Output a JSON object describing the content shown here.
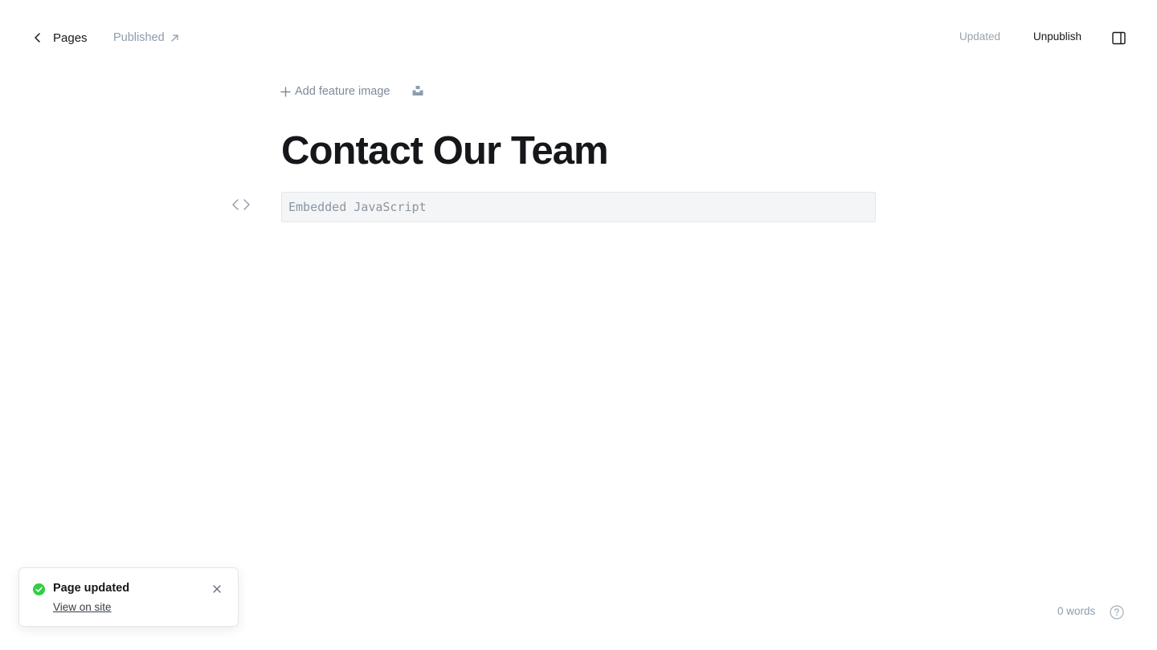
{
  "header": {
    "back_label": "Pages",
    "status_label": "Published",
    "save_state": "Updated",
    "unpublish_label": "Unpublish"
  },
  "editor": {
    "feature_image_label": "Add feature image",
    "title": "Contact Our Team",
    "embed_placeholder": "Embedded JavaScript"
  },
  "toast": {
    "title": "Page updated",
    "link_label": "View on site"
  },
  "footer": {
    "word_count": "0 words"
  },
  "colors": {
    "accent_success": "#30cf43",
    "text_primary": "#15171a",
    "text_muted": "#8e9cac"
  }
}
